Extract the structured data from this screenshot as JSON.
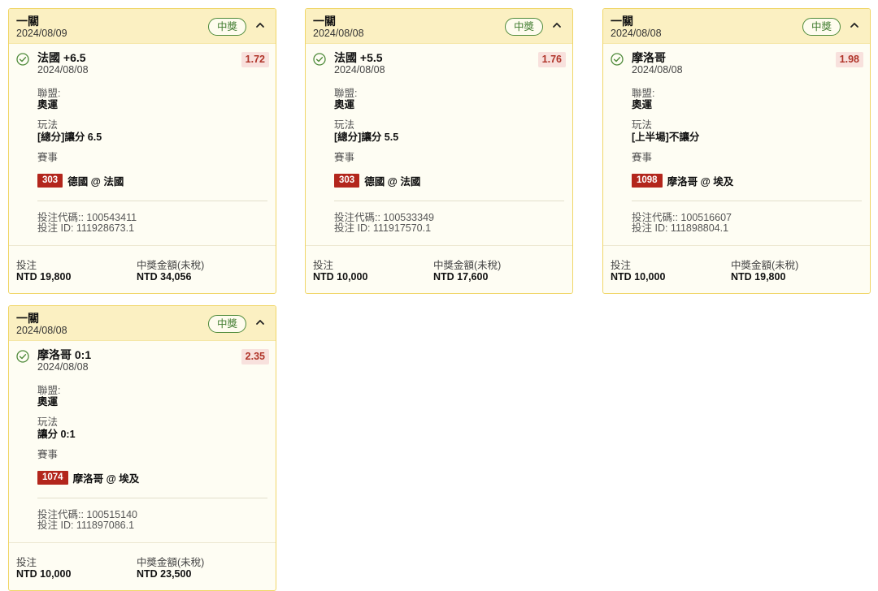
{
  "labels": {
    "league": "聯盟:",
    "play": "玩法",
    "event": "賽事",
    "bet_code": "投注代碼:: ",
    "bet_id": "投注 ID: ",
    "stake": "投注",
    "payout": "中獎金額(未稅)"
  },
  "colors": {
    "card_border": "#f0d668",
    "header_bg": "#fbf0c2",
    "win_green": "#3e7a2c",
    "odds_red": "#b0352a",
    "event_code_bg": "#b3261c"
  },
  "icons": {
    "status": "check-circle-icon",
    "collapse": "chevron-up-icon"
  },
  "cards": [
    {
      "title": "一關",
      "date": "2024/08/09",
      "status": "中獎",
      "selection": "法國 +6.5",
      "selection_date": "2024/08/08",
      "odds": "1.72",
      "league": "奧運",
      "play": "[總分]讓分 6.5",
      "event_code": "303",
      "event_name": "德國 @ 法國",
      "bet_code": "100543411",
      "bet_id": "111928673.1",
      "stake": "NTD 19,800",
      "payout": "NTD 34,056"
    },
    {
      "title": "一關",
      "date": "2024/08/08",
      "status": "中獎",
      "selection": "法國 +5.5",
      "selection_date": "2024/08/08",
      "odds": "1.76",
      "league": "奧運",
      "play": "[總分]讓分 5.5",
      "event_code": "303",
      "event_name": "德國 @ 法國",
      "bet_code": "100533349",
      "bet_id": "111917570.1",
      "stake": "NTD 10,000",
      "payout": "NTD 17,600"
    },
    {
      "title": "一關",
      "date": "2024/08/08",
      "status": "中獎",
      "selection": "摩洛哥",
      "selection_date": "2024/08/08",
      "odds": "1.98",
      "league": "奧運",
      "play": "[上半場]不讓分",
      "event_code": "1098",
      "event_name": "摩洛哥 @ 埃及",
      "bet_code": "100516607",
      "bet_id": "111898804.1",
      "stake": "NTD 10,000",
      "payout": "NTD 19,800"
    },
    {
      "title": "一關",
      "date": "2024/08/08",
      "status": "中獎",
      "selection": "摩洛哥 0:1",
      "selection_date": "2024/08/08",
      "odds": "2.35",
      "league": "奧運",
      "play": "讓分 0:1",
      "event_code": "1074",
      "event_name": "摩洛哥 @ 埃及",
      "bet_code": "100515140",
      "bet_id": "111897086.1",
      "stake": "NTD 10,000",
      "payout": "NTD 23,500"
    }
  ]
}
